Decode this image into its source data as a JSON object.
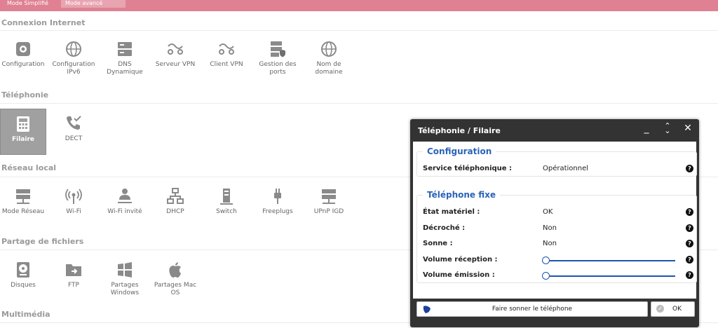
{
  "topbar": {
    "mode_simple": "Mode Simplifié",
    "mode_advanced": "Mode avancé"
  },
  "sections": {
    "internet": {
      "title": "Connexion Internet",
      "items": [
        {
          "label": "Configuration",
          "icon": "gear-icon"
        },
        {
          "label": "Configuration IPv6",
          "icon": "globe-icon"
        },
        {
          "label": "DNS Dynamique",
          "icon": "server-icon"
        },
        {
          "label": "Serveur VPN",
          "icon": "vpn-icon"
        },
        {
          "label": "Client VPN",
          "icon": "vpn-icon"
        },
        {
          "label": "Gestion des ports",
          "icon": "server-shield-icon"
        },
        {
          "label": "Nom de domaine",
          "icon": "globe-icon"
        }
      ]
    },
    "telephony": {
      "title": "Téléphonie",
      "items": [
        {
          "label": "Filaire",
          "icon": "desk-phone-icon"
        },
        {
          "label": "DECT",
          "icon": "phone-check-icon"
        }
      ]
    },
    "lan": {
      "title": "Réseau local",
      "items": [
        {
          "label": "Mode Réseau",
          "icon": "network-box-icon"
        },
        {
          "label": "Wi-Fi",
          "icon": "wifi-icon"
        },
        {
          "label": "Wi-Fi invité",
          "icon": "guest-wifi-icon"
        },
        {
          "label": "DHCP",
          "icon": "dhcp-icon"
        },
        {
          "label": "Switch",
          "icon": "switch-icon"
        },
        {
          "label": "Freeplugs",
          "icon": "plug-icon"
        },
        {
          "label": "UPnP IGD",
          "icon": "upnp-icon"
        }
      ]
    },
    "sharing": {
      "title": "Partage de fichiers",
      "items": [
        {
          "label": "Disques",
          "icon": "disk-icon"
        },
        {
          "label": "FTP",
          "icon": "ftp-folder-icon"
        },
        {
          "label": "Partages Windows",
          "icon": "windows-icon"
        },
        {
          "label": "Partages Mac OS",
          "icon": "apple-icon"
        }
      ]
    },
    "multimedia": {
      "title": "Multimédia"
    }
  },
  "dialog": {
    "title": "Téléphonie / Filaire",
    "config": {
      "legend": "Configuration",
      "service_label": "Service téléphonique :",
      "service_value": "Opérationnel"
    },
    "fixed": {
      "legend": "Téléphone fixe",
      "state_label": "État matériel :",
      "state_value": "OK",
      "offhook_label": "Décroché :",
      "offhook_value": "Non",
      "ring_label": "Sonne :",
      "ring_value": "Non",
      "vol_rx_label": "Volume réception :",
      "vol_rx_level": 0,
      "vol_tx_label": "Volume émission :",
      "vol_tx_level": 0
    },
    "footer": {
      "ring_button": "Faire sonner le téléphone",
      "ok_button": "OK"
    },
    "help_glyph": "?"
  },
  "colors": {
    "topbar": "#df8193",
    "accent_blue": "#2b63b8",
    "active_tile": "#a0a0a0",
    "dialog_frame": "#333333"
  }
}
